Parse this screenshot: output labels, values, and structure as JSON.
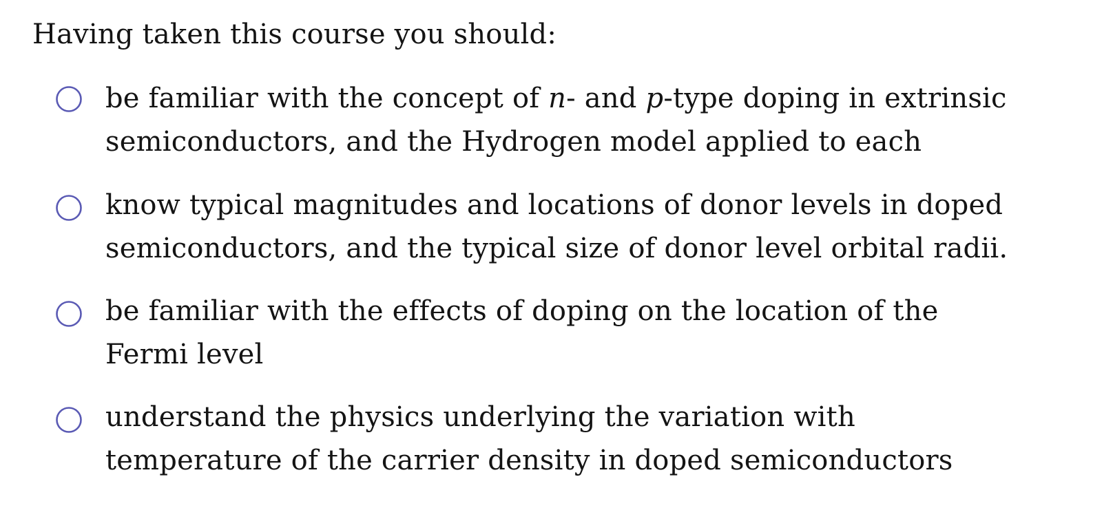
{
  "heading": "Having taken this course you should:",
  "items": [
    {
      "segments_line1": [
        "be familiar with the concept of ",
        "n",
        "- and ",
        "p",
        "-type doping in extrinsic"
      ],
      "line2": "semiconductors, and the Hydrogen model applied to each"
    },
    {
      "line1": "know typical magnitudes and locations of donor levels in doped",
      "line2": "semiconductors, and the typical size of donor level orbital radii."
    },
    {
      "line1": "be familiar with the effects of doping on the location of the",
      "line2": "Fermi level"
    },
    {
      "line1": "understand the physics underlying the variation with",
      "line2": "temperature of the carrier density in doped semiconductors"
    }
  ],
  "colors": {
    "bullet_stroke": "#5a5ab4",
    "text": "#141414",
    "background": "#ffffff"
  },
  "icons": {
    "bullet": "hollow-circle-icon"
  }
}
